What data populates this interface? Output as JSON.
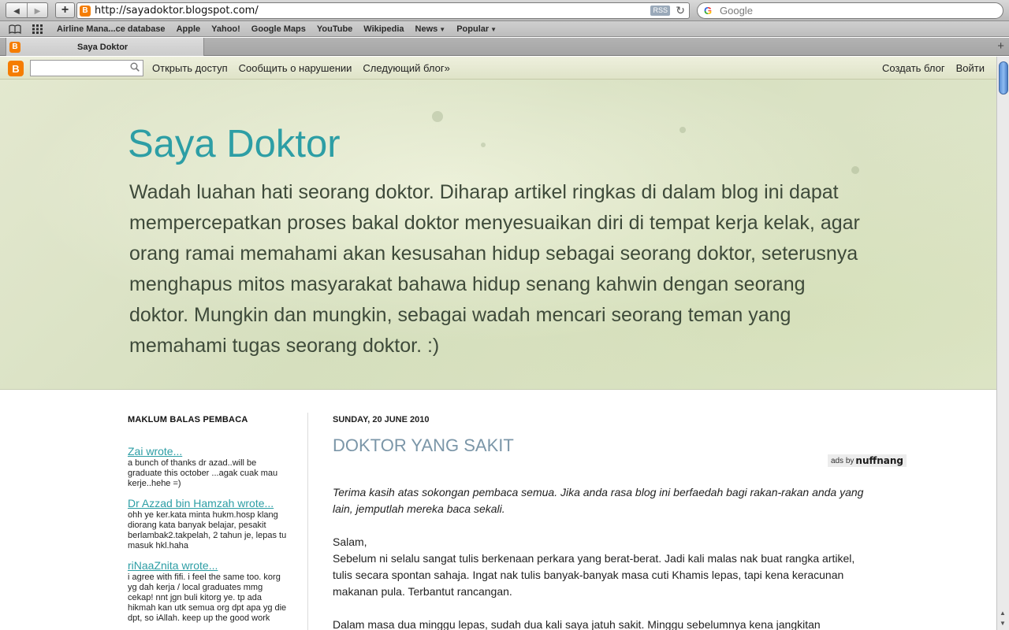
{
  "browser": {
    "url": "http://sayadoktor.blogspot.com/",
    "rss_label": "RSS",
    "search_placeholder": "Google",
    "tab_title": "Saya Doktor",
    "bookmarks": [
      {
        "label": "Airline Mana...ce database",
        "menu": false
      },
      {
        "label": "Apple",
        "menu": false
      },
      {
        "label": "Yahoo!",
        "menu": false
      },
      {
        "label": "Google Maps",
        "menu": false
      },
      {
        "label": "YouTube",
        "menu": false
      },
      {
        "label": "Wikipedia",
        "menu": false
      },
      {
        "label": "News",
        "menu": true
      },
      {
        "label": "Popular",
        "menu": true
      }
    ]
  },
  "navbar": {
    "links": [
      "Открыть доступ",
      "Сообщить о нарушении",
      "Следующий блог»"
    ],
    "right_links": [
      "Создать блог",
      "Войти"
    ]
  },
  "header": {
    "title": "Saya Doktor",
    "description": "Wadah luahan hati seorang doktor. Diharap artikel ringkas di dalam blog ini dapat mempercepatkan proses bakal doktor menyesuaikan diri di tempat kerja kelak, agar orang ramai memahami akan kesusahan hidup sebagai seorang doktor, seterusnya menghapus mitos masyarakat bahawa hidup senang kahwin dengan seorang doktor. Mungkin dan mungkin, sebagai wadah mencari seorang teman yang memahami tugas seorang doktor. :)"
  },
  "sidebar": {
    "heading": "MAKLUM BALAS PEMBACA",
    "comments": [
      {
        "author": "Zai wrote...",
        "body": "a bunch of thanks dr azad..will be graduate this october ...agak cuak mau kerje..hehe =)"
      },
      {
        "author": "Dr Azzad bin Hamzah wrote...",
        "body": "ohh ye ker.kata minta hukm.hosp klang diorang kata banyak belajar, pesakit berlambak2.takpelah, 2 tahun je, lepas tu masuk hkl.haha"
      },
      {
        "author": "riNaaZnita wrote...",
        "body": "i agree with fifi. i feel the same too. korg yg dah kerja / local graduates mmg cekap! nnt jgn buli kitorg ye. tp ada hikmah kan utk semua org dpt apa yg die dpt, so iAllah. keep up the good work"
      }
    ]
  },
  "post": {
    "date": "SUNDAY, 20 JUNE 2010",
    "title": "DOKTOR YANG SAKIT",
    "ads_prefix": "ads by",
    "ads_brand": "nuffnang",
    "intro": "Terima kasih atas sokongan pembaca semua. Jika anda rasa blog ini berfaedah bagi rakan-rakan anda yang lain, jemputlah mereka baca sekali.",
    "paragraphs": [
      "Salam,\nSebelum ni selalu sangat tulis berkenaan perkara yang berat-berat. Jadi kali malas nak buat rangka artikel, tulis secara spontan sahaja. Ingat nak tulis banyak-banyak masa cuti Khamis lepas, tapi kena keracunan makanan pula. Terbantut rancangan.",
      "Dalam masa dua minggu lepas, sudah dua kali saya jatuh sakit. Minggu sebelumnya kena jangkitan"
    ]
  }
}
